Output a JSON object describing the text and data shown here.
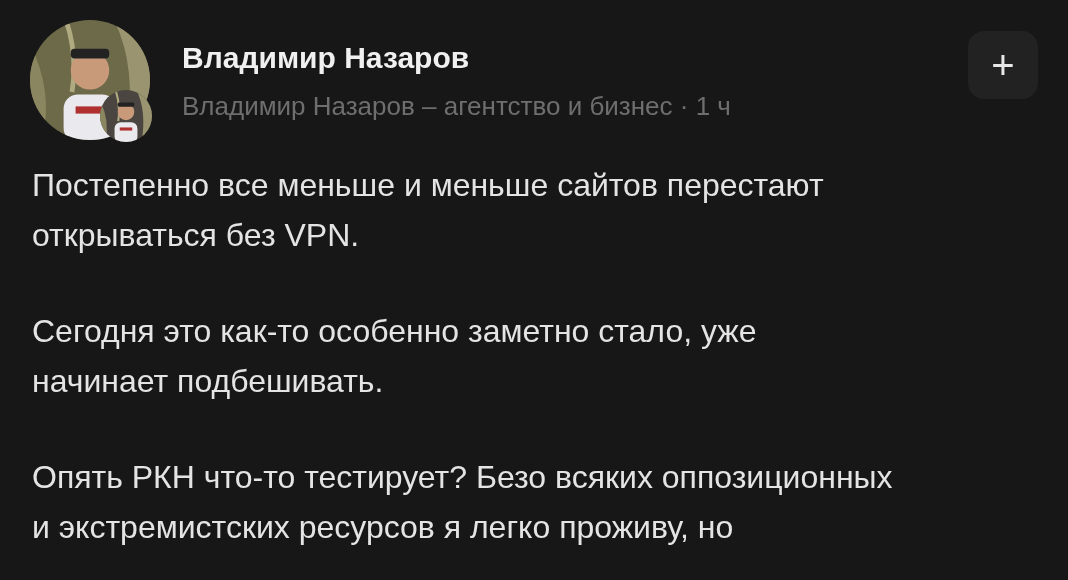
{
  "post": {
    "author": "Владимир Назаров",
    "source": "Владимир Назаров – агентство и бизнес · 1 ч",
    "add_button": "+",
    "paragraphs": [
      {
        "lines": [
          "Постепенно все меньше и меньше сайтов перестают",
          "открываться без VPN."
        ]
      },
      {
        "lines": [
          "Сегодня это как-то особенно заметно стало, уже",
          "начинает подбешивать."
        ]
      },
      {
        "lines": [
          "Опять РКН что-то тестирует? Безо всяких оппозиционных",
          "и экстремистских ресурсов я легко проживу, но"
        ]
      }
    ]
  }
}
